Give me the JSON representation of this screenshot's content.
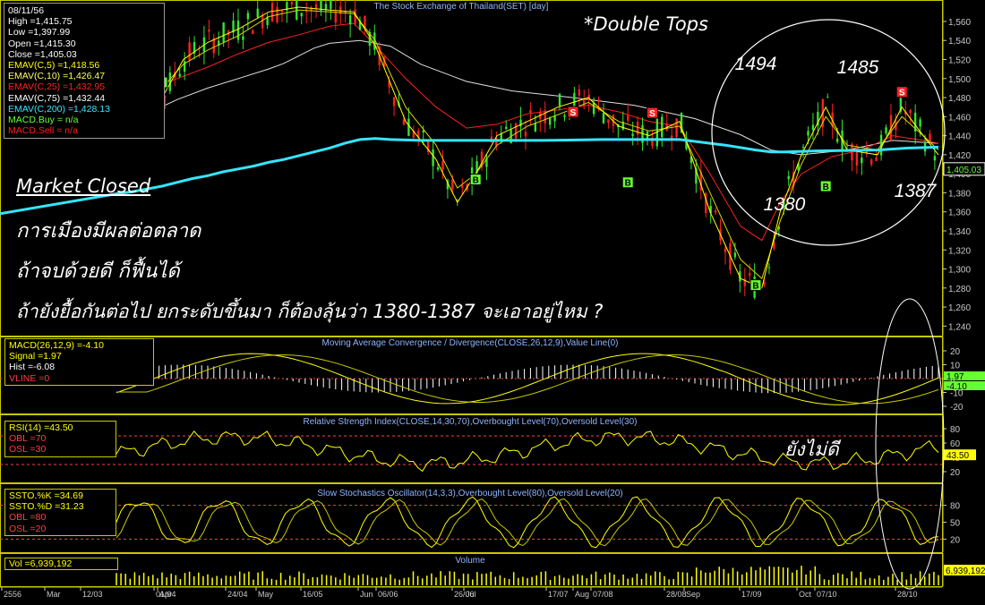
{
  "chart_data": [
    {
      "type": "candlestick",
      "title": "The Stock Exchange of Thailand(SET) [day]",
      "series": [
        {
          "name": "EMAV(C,5)",
          "color": "#ffff00"
        },
        {
          "name": "EMAV(C,10)",
          "color": "#d6d600"
        },
        {
          "name": "EMAV(C,25)",
          "color": "#ff2020"
        },
        {
          "name": "EMAV(C,75)",
          "color": "#e0e0e0"
        },
        {
          "name": "EMAV(C,200)",
          "color": "#33e6ff"
        }
      ],
      "ylim": [
        1230,
        1575
      ],
      "y_ticks": [
        "1,560",
        "1,540",
        "1,520",
        "1,500",
        "1,480",
        "1,460",
        "1,440",
        "1,420",
        "1,400",
        "1,380",
        "1,360",
        "1,340",
        "1,320",
        "1,300",
        "1,280",
        "1,260",
        "1,240"
      ],
      "last_price_label": "1,405.03",
      "ema200_path": [
        [
          0,
          1379
        ],
        [
          5,
          1381
        ],
        [
          10,
          1384
        ],
        [
          15,
          1387
        ],
        [
          20,
          1391
        ],
        [
          25,
          1395
        ],
        [
          30,
          1398
        ],
        [
          35,
          1402
        ],
        [
          40,
          1405
        ],
        [
          45,
          1408
        ],
        [
          50,
          1412
        ],
        [
          55,
          1415
        ],
        [
          60,
          1419
        ],
        [
          65,
          1423
        ],
        [
          70,
          1427
        ],
        [
          75,
          1432
        ],
        [
          80,
          1436
        ],
        [
          85,
          1437
        ],
        [
          90,
          1436
        ],
        [
          100,
          1435
        ],
        [
          120,
          1435
        ],
        [
          140,
          1435
        ],
        [
          160,
          1436
        ],
        [
          185,
          1436
        ],
        [
          200,
          1430
        ],
        [
          210,
          1425
        ],
        [
          215,
          1423
        ],
        [
          220,
          1423
        ],
        [
          230,
          1424
        ],
        [
          250,
          1425
        ],
        [
          260,
          1427
        ],
        [
          270,
          1428
        ]
      ],
      "ema75_path": [
        [
          0,
          1452
        ],
        [
          10,
          1463
        ],
        [
          20,
          1478
        ],
        [
          30,
          1490
        ],
        [
          40,
          1500
        ],
        [
          50,
          1510
        ],
        [
          55,
          1516
        ],
        [
          65,
          1532
        ],
        [
          70,
          1537
        ],
        [
          80,
          1540
        ],
        [
          90,
          1534
        ],
        [
          100,
          1515
        ],
        [
          115,
          1497
        ],
        [
          130,
          1487
        ],
        [
          150,
          1480
        ],
        [
          170,
          1472
        ],
        [
          190,
          1458
        ],
        [
          205,
          1441
        ],
        [
          215,
          1425
        ],
        [
          225,
          1420
        ],
        [
          240,
          1425
        ],
        [
          255,
          1435
        ],
        [
          270,
          1432
        ]
      ],
      "ema25_path": [
        [
          0,
          1470
        ],
        [
          10,
          1489
        ],
        [
          20,
          1500
        ],
        [
          30,
          1512
        ],
        [
          40,
          1526
        ],
        [
          50,
          1538
        ],
        [
          60,
          1546
        ],
        [
          70,
          1555
        ],
        [
          78,
          1558
        ],
        [
          85,
          1535
        ],
        [
          95,
          1500
        ],
        [
          105,
          1470
        ],
        [
          115,
          1448
        ],
        [
          125,
          1452
        ],
        [
          135,
          1463
        ],
        [
          145,
          1467
        ],
        [
          155,
          1472
        ],
        [
          165,
          1465
        ],
        [
          175,
          1455
        ],
        [
          185,
          1450
        ],
        [
          195,
          1400
        ],
        [
          205,
          1345
        ],
        [
          212,
          1330
        ],
        [
          218,
          1370
        ],
        [
          225,
          1400
        ],
        [
          235,
          1418
        ],
        [
          245,
          1425
        ],
        [
          255,
          1440
        ],
        [
          265,
          1435
        ],
        [
          270,
          1432
        ]
      ],
      "ema10_path": [
        [
          0,
          1528
        ],
        [
          8,
          1535
        ],
        [
          15,
          1490
        ],
        [
          22,
          1515
        ],
        [
          30,
          1530
        ],
        [
          40,
          1545
        ],
        [
          50,
          1565
        ],
        [
          60,
          1572
        ],
        [
          70,
          1570
        ],
        [
          78,
          1568
        ],
        [
          85,
          1540
        ],
        [
          95,
          1470
        ],
        [
          105,
          1430
        ],
        [
          112,
          1385
        ],
        [
          118,
          1400
        ],
        [
          125,
          1430
        ],
        [
          135,
          1450
        ],
        [
          145,
          1462
        ],
        [
          155,
          1475
        ],
        [
          165,
          1455
        ],
        [
          175,
          1445
        ],
        [
          185,
          1450
        ],
        [
          195,
          1380
        ],
        [
          205,
          1310
        ],
        [
          212,
          1290
        ],
        [
          218,
          1350
        ],
        [
          225,
          1410
        ],
        [
          233,
          1460
        ],
        [
          240,
          1430
        ],
        [
          250,
          1425
        ],
        [
          258,
          1460
        ],
        [
          265,
          1440
        ],
        [
          270,
          1425
        ]
      ],
      "ema5_path": [
        [
          0,
          1530
        ],
        [
          8,
          1540
        ],
        [
          15,
          1480
        ],
        [
          22,
          1520
        ],
        [
          30,
          1538
        ],
        [
          40,
          1552
        ],
        [
          50,
          1570
        ],
        [
          60,
          1575
        ],
        [
          70,
          1572
        ],
        [
          78,
          1570
        ],
        [
          85,
          1535
        ],
        [
          95,
          1455
        ],
        [
          105,
          1415
        ],
        [
          112,
          1370
        ],
        [
          118,
          1400
        ],
        [
          125,
          1440
        ],
        [
          135,
          1455
        ],
        [
          145,
          1470
        ],
        [
          155,
          1480
        ],
        [
          165,
          1450
        ],
        [
          175,
          1440
        ],
        [
          185,
          1455
        ],
        [
          195,
          1360
        ],
        [
          205,
          1290
        ],
        [
          212,
          1280
        ],
        [
          218,
          1360
        ],
        [
          225,
          1420
        ],
        [
          233,
          1470
        ],
        [
          240,
          1425
        ],
        [
          250,
          1420
        ],
        [
          258,
          1470
        ],
        [
          265,
          1440
        ],
        [
          270,
          1420
        ]
      ],
      "signal_buy_marks": [
        [
          15,
          1496
        ],
        [
          118,
          1394
        ],
        [
          168,
          1391
        ],
        [
          210,
          1283
        ],
        [
          233,
          1387
        ]
      ],
      "signal_sell_marks": [
        [
          150,
          1465
        ],
        [
          176,
          1464
        ],
        [
          258,
          1486
        ]
      ],
      "annotations": [
        {
          "label": "1494",
          "x_day": 230,
          "y_price": 1494
        },
        {
          "label": "1485",
          "x_day": 258,
          "y_price": 1485
        },
        {
          "label": "1380",
          "x_day": 236,
          "y_price": 1380
        },
        {
          "label": "1387",
          "x_day": 270,
          "y_price": 1387
        }
      ]
    },
    {
      "type": "line",
      "title": "Moving Average Convergence / Divergence(CLOSE,26,12,9),Value Line(0)",
      "series": [
        {
          "name": "MACD(26,12,9)",
          "color": "#ffff00"
        },
        {
          "name": "Signal",
          "color": "#c8c800"
        },
        {
          "name": "Hist",
          "color": "#ffffff"
        }
      ],
      "ylim": [
        -25,
        25
      ],
      "y_ticks": [
        "20",
        "10",
        "0",
        "-10",
        "-20"
      ],
      "value_labels": [
        "1.97",
        "-4.10"
      ]
    },
    {
      "type": "line",
      "title": "Relative Strength Index(CLOSE,14,30,70),Overbought Level(70),Oversold Level(30)",
      "series": [
        {
          "name": "RSI(14)",
          "color": "#ffff00"
        }
      ],
      "ylim": [
        10,
        90
      ],
      "y_ticks": [
        "80",
        "60",
        "40",
        "20"
      ],
      "value_labels": [
        "43.50"
      ]
    },
    {
      "type": "line",
      "title": "Slow Stochastics Oscillator(14,3,3),Overbought Level(80),Oversold Level(20)",
      "series": [
        {
          "name": "SSTO.%K",
          "color": "#ffff00"
        },
        {
          "name": "SSTO.%D",
          "color": "#c8c800"
        }
      ],
      "ylim": [
        0,
        100
      ],
      "y_ticks": [
        "80",
        "50",
        "20"
      ]
    },
    {
      "type": "bar",
      "title": "Volume",
      "series": [
        {
          "name": "Volume",
          "color": "#ffff00"
        }
      ],
      "value_labels": [
        "6,939,192"
      ]
    }
  ],
  "x_axis_labels": [
    "2556",
    "Mar",
    "12/03",
    "01/04",
    "Apr",
    "24/04",
    "May",
    "16/05",
    "Jun",
    "06/06",
    "26/06",
    "Jul",
    "17/07",
    "Aug",
    "07/08",
    "28/08",
    "Sep",
    "17/09",
    "Oct",
    "07/10",
    "28/10"
  ],
  "info_box": {
    "rows": [
      {
        "text": "08/11/56",
        "color": "#ffffff"
      },
      {
        "text": "High  =1,415.75",
        "color": "#ffffff"
      },
      {
        "text": "Low   =1,397.99",
        "color": "#ffffff"
      },
      {
        "text": "Open  =1,415.30",
        "color": "#ffffff"
      },
      {
        "text": "Close  =1,405.03",
        "color": "#ffffff"
      },
      {
        "text": "EMAV(C,5)   =1,418.56",
        "color": "#ffff00"
      },
      {
        "text": "EMAV(C,10)   =1,426.47",
        "color": "#ffff66"
      },
      {
        "text": "EMAV(C,25)   =1,432.95",
        "color": "#ff2020"
      },
      {
        "text": "EMAV(C,75)   =1,432.44",
        "color": "#ffffff"
      },
      {
        "text": "EMAV(C,200)  =1,428.13",
        "color": "#33e6ff"
      },
      {
        "text": "MACD.Buy  = n/a",
        "color": "#66ff33"
      },
      {
        "text": "MACD.Sell  = n/a",
        "color": "#ff2020"
      }
    ]
  },
  "macd_box": {
    "rows": [
      {
        "text": "MACD(26,12,9)  =-4.10",
        "color": "#ffff00"
      },
      {
        "text": "Signal  =1.97",
        "color": "#ffff00"
      },
      {
        "text": "Hist  =-6.08",
        "color": "#ffffff"
      },
      {
        "text": "VLINE   =0",
        "color": "#ff4040"
      }
    ]
  },
  "rsi_box": {
    "rows": [
      {
        "text": "RSI(14)   =43.50",
        "color": "#ffff00"
      },
      {
        "text": "OBL  =70",
        "color": "#ff4040"
      },
      {
        "text": "OSL  =30",
        "color": "#ff4040"
      }
    ]
  },
  "ssto_box": {
    "rows": [
      {
        "text": "SSTO.%K   =34.69",
        "color": "#ffff00"
      },
      {
        "text": "SSTO.%D   =31.23",
        "color": "#ffff00"
      },
      {
        "text": "OBL  =80",
        "color": "#ff4040"
      },
      {
        "text": "OSL  =20",
        "color": "#ff4040"
      }
    ]
  },
  "vol_box": {
    "rows": [
      {
        "text": "Vol  =6,939,192",
        "color": "#ffff00"
      }
    ]
  },
  "overlay_text": {
    "double_tops": "*Double Tops",
    "market_closed": "Market Closed",
    "thai_line1": "การเมืองมีผลต่อตลาด",
    "thai_line2": "ถ้าจบด้วยดี ก็ฟื้นได้",
    "thai_line3": "ถ้ายังยื้อกันต่อไป ยกระดับขึ้นมา ก็ต้องลุ้นว่า 1380-1387 จะเอาอยู่ไหม ?",
    "not_good": "ยังไม่ดี",
    "signal_buy": "B",
    "signal_sell": "S"
  },
  "colors": {
    "background": "#000000",
    "candle_up": "#33e633",
    "candle_down": "#ff2020",
    "grid": "#ffffff",
    "panel_border": "#c8c800",
    "axis_text": "#c8c8c8"
  }
}
